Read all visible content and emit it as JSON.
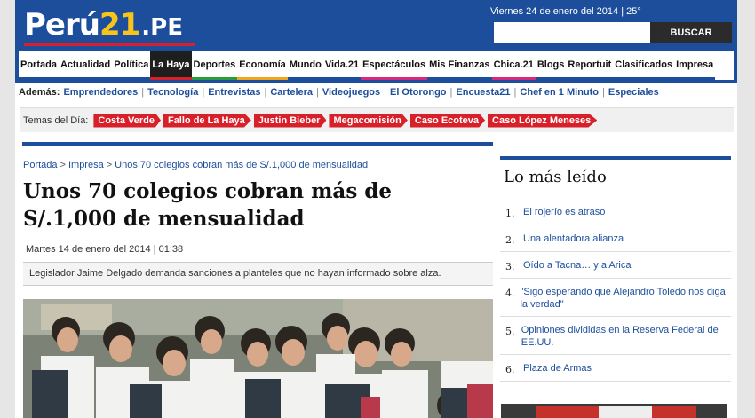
{
  "header": {
    "logo_main": "Perú",
    "logo_num": "21",
    "logo_tld": ".PE",
    "date_weather": "Viernes 24 de enero del 2014 | 25°",
    "search_placeholder": "",
    "search_button": "BUSCAR"
  },
  "mainnav": [
    {
      "label": "Portada",
      "color": "#1c4e9c"
    },
    {
      "label": "Actualidad",
      "color": "#1c4e9c"
    },
    {
      "label": "Política",
      "color": "#1c4e9c"
    },
    {
      "label": "La Haya",
      "color": "#d8202a",
      "active": true
    },
    {
      "label": "Deportes",
      "color": "#2a9c3a"
    },
    {
      "label": "Economía",
      "color": "#f0a51b"
    },
    {
      "label": "Mundo",
      "color": "#1c4e9c"
    },
    {
      "label": "Vida.21",
      "color": "#1c4e9c"
    },
    {
      "label": "Espectáculos",
      "color": "#d82a7a"
    },
    {
      "label": "Mis Finanzas",
      "color": "#1c4e9c"
    },
    {
      "label": "Chica.21",
      "color": "#d82a7a"
    },
    {
      "label": "Blogs",
      "color": "#1c4e9c"
    },
    {
      "label": "Reportuit",
      "color": "#1c4e9c"
    },
    {
      "label": "Clasificados",
      "color": "#1c4e9c"
    },
    {
      "label": "Impresa",
      "color": "#1c4e9c"
    }
  ],
  "secnav": {
    "label": "Además:",
    "links": [
      "Emprendedores",
      "Tecnología",
      "Entrevistas",
      "Cartelera",
      "Videojuegos",
      "El Otorongo",
      "Encuesta21",
      "Chef en 1 Minuto",
      "Especiales"
    ]
  },
  "topics": {
    "label": "Temas del Día:",
    "tags": [
      "Costa Verde",
      "Fallo de La Haya",
      "Justin Bieber",
      "Megacomisión",
      "Caso Ecoteva",
      "Caso López Meneses"
    ]
  },
  "article": {
    "breadcrumb": [
      "Portada",
      "Impresa",
      "Unos 70 colegios cobran más de S/.1,000 de mensualidad"
    ],
    "breadcrumb_sep": ">",
    "headline": "Unos 70 colegios cobran más de S/.1,000 de mensualidad",
    "date": "Martes 14 de enero del 2014 | 01:38",
    "summary": "Legislador Jaime Delgado demanda sanciones a planteles que no hayan informado sobre alza."
  },
  "sidebar": {
    "title": "Lo más leído",
    "items": [
      {
        "num": "1.",
        "text": "El rojerío es atraso"
      },
      {
        "num": "2.",
        "text": "Una alentadora alianza"
      },
      {
        "num": "3.",
        "text": "Oído a Tacna… y a Arica"
      },
      {
        "num": "4.",
        "text": "\"Sigo esperando que Alejandro Toledo nos diga la verdad\""
      },
      {
        "num": "5.",
        "text": "Opiniones divididas en la Reserva Federal de EE.UU."
      },
      {
        "num": "6.",
        "text": "Plaza de Armas"
      }
    ]
  }
}
